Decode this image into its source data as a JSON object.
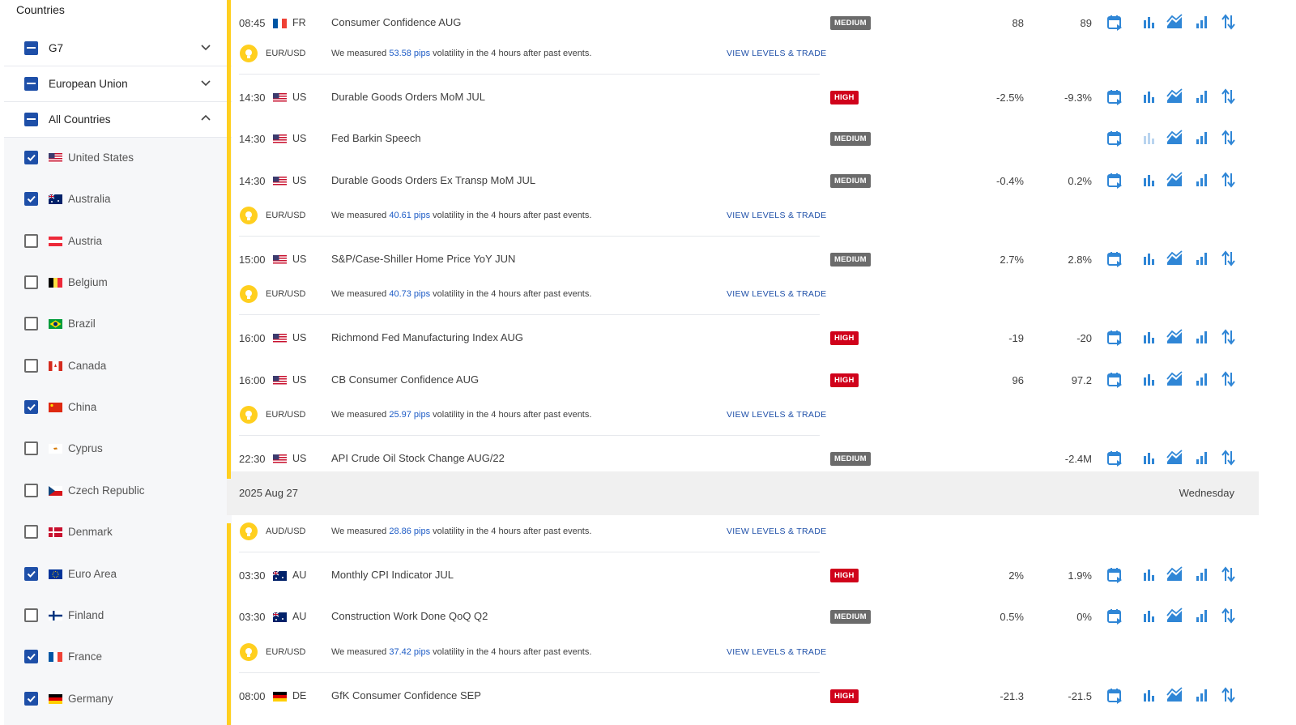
{
  "sidebar": {
    "title": "Countries",
    "groups": [
      {
        "label": "G7",
        "expanded": false
      },
      {
        "label": "European Union",
        "expanded": false
      },
      {
        "label": "All Countries",
        "expanded": true
      }
    ],
    "countries": [
      {
        "name": "United States",
        "checked": true,
        "flag": "us"
      },
      {
        "name": "Australia",
        "checked": true,
        "flag": "au"
      },
      {
        "name": "Austria",
        "checked": false,
        "flag": "at"
      },
      {
        "name": "Belgium",
        "checked": false,
        "flag": "be"
      },
      {
        "name": "Brazil",
        "checked": false,
        "flag": "br"
      },
      {
        "name": "Canada",
        "checked": false,
        "flag": "ca"
      },
      {
        "name": "China",
        "checked": true,
        "flag": "cn"
      },
      {
        "name": "Cyprus",
        "checked": false,
        "flag": "cy"
      },
      {
        "name": "Czech Republic",
        "checked": false,
        "flag": "cz"
      },
      {
        "name": "Denmark",
        "checked": false,
        "flag": "dk"
      },
      {
        "name": "Euro Area",
        "checked": true,
        "flag": "eu"
      },
      {
        "name": "Finland",
        "checked": false,
        "flag": "fi"
      },
      {
        "name": "France",
        "checked": true,
        "flag": "fr"
      },
      {
        "name": "Germany",
        "checked": true,
        "flag": "de"
      }
    ]
  },
  "calendar": {
    "link_label": "VIEW LEVELS & TRADE",
    "vol_prefix": "We measured ",
    "vol_suffix": " volatility in the 4 hours after past events.",
    "day": {
      "date": "2025 Aug 27",
      "weekday": "Wednesday"
    },
    "colors": {
      "accent": "#ffcf1f",
      "high": "#d0021b",
      "medium": "#6b6b6b",
      "link": "#1e4fa8",
      "icon": "#2f86d6"
    },
    "items": [
      {
        "kind": "event",
        "time": "08:45",
        "flag": "fr",
        "country": "FR",
        "event": "Consumer Confidence AUG",
        "impact": "MEDIUM",
        "actual": "88",
        "forecast": "89"
      },
      {
        "kind": "vol",
        "pair": "EUR/USD",
        "pips": "53.58 pips"
      },
      {
        "kind": "event",
        "time": "14:30",
        "flag": "us",
        "country": "US",
        "event": "Durable Goods Orders MoM JUL",
        "impact": "HIGH",
        "actual": "-2.5%",
        "forecast": "-9.3%"
      },
      {
        "kind": "event",
        "time": "14:30",
        "flag": "us",
        "country": "US",
        "event": "Fed Barkin Speech",
        "impact": "MEDIUM",
        "actual": "",
        "forecast": "",
        "dim_chart": true
      },
      {
        "kind": "event",
        "time": "14:30",
        "flag": "us",
        "country": "US",
        "event": "Durable Goods Orders Ex Transp MoM JUL",
        "impact": "MEDIUM",
        "actual": "-0.4%",
        "forecast": "0.2%"
      },
      {
        "kind": "vol",
        "pair": "EUR/USD",
        "pips": "40.61 pips"
      },
      {
        "kind": "event",
        "time": "15:00",
        "flag": "us",
        "country": "US",
        "event": "S&P/Case-Shiller Home Price YoY JUN",
        "impact": "MEDIUM",
        "actual": "2.7%",
        "forecast": "2.8%"
      },
      {
        "kind": "vol",
        "pair": "EUR/USD",
        "pips": "40.73 pips"
      },
      {
        "kind": "event",
        "time": "16:00",
        "flag": "us",
        "country": "US",
        "event": "Richmond Fed Manufacturing Index AUG",
        "impact": "HIGH",
        "actual": "-19",
        "forecast": "-20"
      },
      {
        "kind": "event",
        "time": "16:00",
        "flag": "us",
        "country": "US",
        "event": "CB Consumer Confidence AUG",
        "impact": "HIGH",
        "actual": "96",
        "forecast": "97.2"
      },
      {
        "kind": "vol",
        "pair": "EUR/USD",
        "pips": "25.97 pips"
      },
      {
        "kind": "event",
        "time": "22:30",
        "flag": "us",
        "country": "US",
        "event": "API Crude Oil Stock Change AUG/22",
        "impact": "MEDIUM",
        "actual": "",
        "forecast": "-2.4M"
      },
      {
        "kind": "day"
      },
      {
        "kind": "vol",
        "pair": "AUD/USD",
        "pips": "28.86 pips"
      },
      {
        "kind": "event",
        "time": "03:30",
        "flag": "au",
        "country": "AU",
        "event": "Monthly CPI Indicator JUL",
        "impact": "HIGH",
        "actual": "2%",
        "forecast": "1.9%"
      },
      {
        "kind": "event",
        "time": "03:30",
        "flag": "au",
        "country": "AU",
        "event": "Construction Work Done QoQ Q2",
        "impact": "MEDIUM",
        "actual": "0.5%",
        "forecast": "0%"
      },
      {
        "kind": "vol",
        "pair": "EUR/USD",
        "pips": "37.42 pips"
      },
      {
        "kind": "event",
        "time": "08:00",
        "flag": "de",
        "country": "DE",
        "event": "GfK Consumer Confidence SEP",
        "impact": "HIGH",
        "actual": "-21.3",
        "forecast": "-21.5"
      }
    ]
  }
}
